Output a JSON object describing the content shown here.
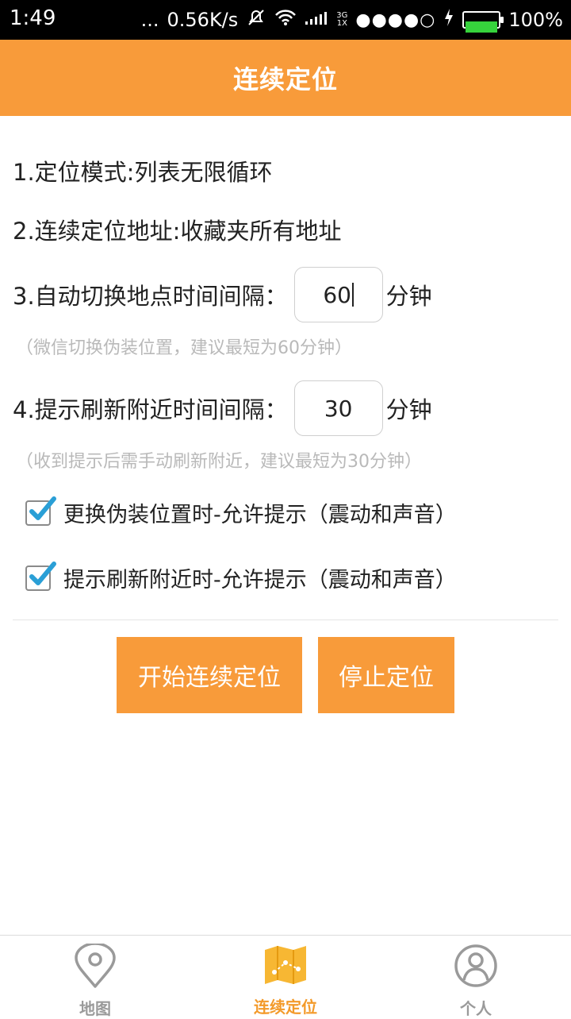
{
  "status_bar": {
    "time": "1:49",
    "more": "...",
    "speed": "0.56K/s",
    "network_small_top": "3G",
    "network_small_bottom": "1X",
    "signal_dots": "●●●●○",
    "battery": "100%"
  },
  "title": "连续定位",
  "settings": {
    "mode_text": "1.定位模式:列表无限循环",
    "address_text": "2.连续定位地址:收藏夹所有地址",
    "switch_interval": {
      "label": "3.自动切换地点时间间隔：",
      "value": "60",
      "unit": "分钟",
      "hint": "（微信切换伪装位置，建议最短为60分钟）"
    },
    "refresh_interval": {
      "label": "4.提示刷新附近时间间隔：",
      "value": "30",
      "unit": "分钟",
      "hint": "（收到提示后需手动刷新附近，建议最短为30分钟）"
    },
    "checkboxes": [
      {
        "label": "更换伪装位置时-允许提示（震动和声音）",
        "checked": true
      },
      {
        "label": "提示刷新附近时-允许提示（震动和声音）",
        "checked": true
      }
    ]
  },
  "buttons": {
    "start": "开始连续定位",
    "stop": "停止定位"
  },
  "nav": {
    "items": [
      {
        "label": "地图",
        "icon": "map-pin-icon",
        "active": false
      },
      {
        "label": "连续定位",
        "icon": "folded-map-icon",
        "active": true
      },
      {
        "label": "个人",
        "icon": "person-icon",
        "active": false
      }
    ]
  },
  "colors": {
    "accent": "#f89b3a",
    "nav_active": "#f39a2a",
    "nav_inactive": "#9a9a9a",
    "checkbox": "#2a9fd6"
  }
}
